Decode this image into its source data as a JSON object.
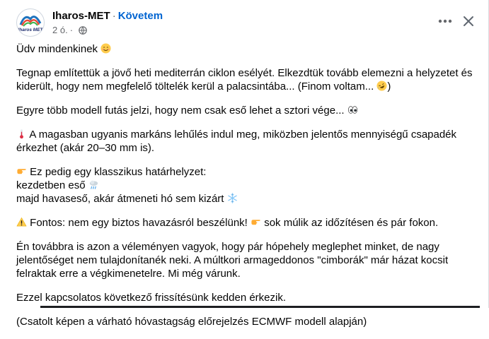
{
  "header": {
    "page_name": "Iharos-MET",
    "separator": "·",
    "follow_label": "Követem",
    "timestamp": "2 ó.",
    "avatar_text": "Iharos MET",
    "privacy_icon": "globe-icon",
    "more_icon": "more-horizontal-icon",
    "close_icon": "close-icon"
  },
  "post": {
    "p1": "Üdv mindenkinek",
    "p2a": "Tegnap említettük a jövő heti mediterrán ciklon esélyét. Elkezdtük tovább elemezni a helyzetet és kiderült, hogy nem megfelelő töltelék kerül a palacsintába... (Finom voltam...",
    "p2b": ")",
    "p3": "Egyre több modell futás jelzi, hogy nem csak eső lehet a sztori vége...",
    "p4": "A magasban ugyanis markáns lehűlés indul meg, miközben jelentős mennyiségű csapadék érkezhet (akár 20–30 mm is).",
    "p5a": "Ez pedig egy klasszikus határhelyzet:",
    "p5b": "kezdetben eső",
    "p5c": "majd havaseső, akár átmeneti hó sem kizárt",
    "p6a": "Fontos: nem egy biztos havazásról beszélünk!",
    "p6b": "sok múlik az időzítésen és pár fokon.",
    "p7": "Én továbbra is azon a véleményen vagyok, hogy pár hópehely meglephet minket, de nagy jelentőséget nem tulajdonítanék neki. A múltkori armageddonos \"cimborák\" már házat kocsit felraktak erre a végkimenetelre. Mi még várunk.",
    "p8": "Ezzel kapcsolatos következő frissítésünk kedden érkezik.",
    "p9": "(Csatolt képen a várható hóvastagság előrejelzés ECMWF modell alapján)"
  },
  "colors": {
    "text": "#050505",
    "secondary": "#65676b",
    "link": "#0064d1"
  }
}
